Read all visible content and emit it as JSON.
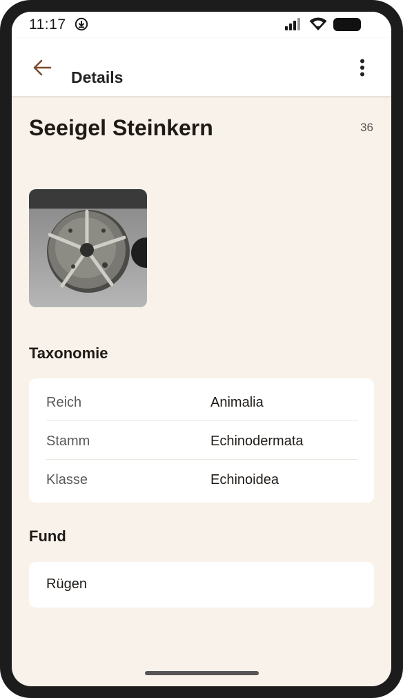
{
  "status_bar": {
    "time": "11:17",
    "download_icon": "download-circle-icon",
    "signal_icon": "cell-signal-icon",
    "wifi_icon": "wifi-icon",
    "battery_icon": "battery-icon"
  },
  "app_bar": {
    "back_icon": "arrow-back-icon",
    "title": "Details",
    "more_icon": "more-vert-icon",
    "accent_color": "#7a4a2a"
  },
  "item": {
    "name": "Seeigel Steinkern",
    "number": "36"
  },
  "taxonomy": {
    "title": "Taxonomie",
    "rows": [
      {
        "label": "Reich",
        "value": "Animalia"
      },
      {
        "label": "Stamm",
        "value": "Echinodermata"
      },
      {
        "label": "Klasse",
        "value": "Echinoidea"
      }
    ]
  },
  "find": {
    "title": "Fund",
    "location": "Rügen"
  },
  "colors": {
    "background": "#f8f2ea",
    "card": "#ffffff",
    "text": "#1f1a16",
    "label": "#5a5a5a"
  }
}
